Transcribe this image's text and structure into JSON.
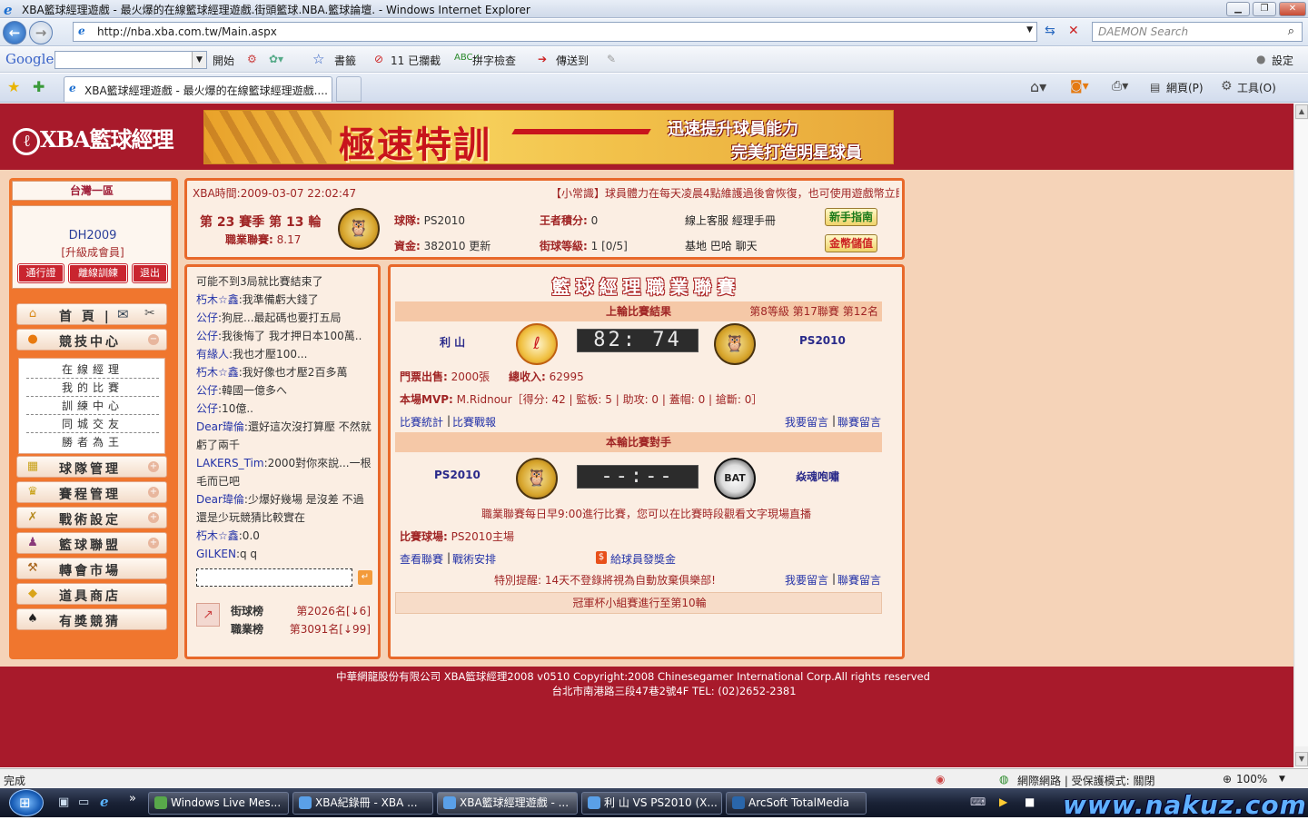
{
  "window": {
    "title": "XBA籃球經理遊戲 - 最火爆的在線籃球經理遊戲.街頭籃球.NBA.籃球論壇. - Windows Internet Explorer"
  },
  "address": {
    "url": "http://nba.xba.com.tw/Main.aspx",
    "search_placeholder": "DAEMON Search"
  },
  "google_bar": {
    "logo": "Google",
    "open": "開始",
    "bookmarks": "書籤",
    "blocked": "11 已攔截",
    "spell": "拼字檢查",
    "send": "傳送到",
    "settings": "設定"
  },
  "tabs": [
    {
      "label": "XBA籃球經理遊戲 - 最火爆的在線籃球經理遊戲...."
    }
  ],
  "ie_toolbar": {
    "page": "網頁(P)",
    "tools": "工具(O)"
  },
  "site": {
    "logo": "XBA籃球經理",
    "banner": {
      "big": "極速特訓",
      "line1": "迅速提升球員能力",
      "line2": "完美打造明星球員"
    }
  },
  "left": {
    "zone": "台灣一區",
    "user": "DH2009",
    "grade": "[升級成會員]",
    "buttons": [
      "通行證",
      "離線訓練",
      "退出"
    ],
    "menu": [
      {
        "label": "首 頁 |",
        "icon": "home-icon"
      },
      {
        "label": "競技中心",
        "icon": "basketball-icon"
      },
      {
        "label": "球隊管理",
        "icon": "team-icon"
      },
      {
        "label": "賽程管理",
        "icon": "trophy-icon"
      },
      {
        "label": "戰術設定",
        "icon": "tactics-icon"
      },
      {
        "label": "籃球聯盟",
        "icon": "league-icon"
      },
      {
        "label": "轉會市場",
        "icon": "hammer-icon"
      },
      {
        "label": "道具商店",
        "icon": "shop-icon"
      },
      {
        "label": "有獎競猜",
        "icon": "spade-icon"
      }
    ],
    "submenu": [
      "在線經理",
      "我的比賽",
      "訓練中心",
      "同城交友",
      "勝者為王"
    ]
  },
  "info": {
    "time_label": "XBA時間:",
    "time": "2009-03-07 22:02:47",
    "tip": "【小常識】球員體力在每天凌晨4點維護過後會恢復，也可使用遊戲幣立即",
    "season": "第 23 賽季 第 13 輪",
    "rating_label": "職業聯賽:",
    "rating": "8.17",
    "team_label": "球隊:",
    "team": "PS2010",
    "funds_label": "資金:",
    "funds": "382010",
    "update": "更新",
    "king_label": "王者積分:",
    "king": "0",
    "street_label": "街球等級:",
    "street": "1 [0/5]",
    "links1": "線上客服  經理手冊",
    "links2": "基地  巴哈  聊天",
    "newbie": "新手指南",
    "deposit": "金幣儲值"
  },
  "chat": {
    "messages": [
      {
        "who": "",
        "text": "可能不到3局就比賽結束了"
      },
      {
        "who": "朽木☆鑫",
        "text": ":我準備虧大錢了"
      },
      {
        "who": "公仔",
        "text": ":狗屁...最起碼也要打五局"
      },
      {
        "who": "公仔",
        "text": ":我後悔了 我才押日本100萬.."
      },
      {
        "who": "有緣人",
        "text": ":我也才壓100..."
      },
      {
        "who": "朽木☆鑫",
        "text": ":我好像也才壓2百多萬"
      },
      {
        "who": "公仔",
        "text": ":韓國一億多へ"
      },
      {
        "who": "公仔",
        "text": ":10億.."
      },
      {
        "who": "Dear瑋倫",
        "text": ":還好這次沒打算壓 不然就虧了兩千"
      },
      {
        "who": "LAKERS_Tim",
        "text": ":2000對你來說...一根毛而已吧"
      },
      {
        "who": "Dear瑋倫",
        "text": ":少爆好幾場 是沒差 不過還是少玩競猜比較實在"
      },
      {
        "who": "朽木☆鑫",
        "text": ":0.0"
      },
      {
        "who": "GILKEN",
        "text": ":q q"
      }
    ],
    "street_rank_label": "街球榜",
    "street_rank": "第2026名[↓6]",
    "pro_rank_label": "職業榜",
    "pro_rank": "第3091名[↓99]"
  },
  "league": {
    "title": "籃球經理職業聯賽",
    "last_result": "上輪比賽結果",
    "level_info": "第8等級 第17聯賽 第12名",
    "home": "利 山",
    "away": "PS2010",
    "score": "82: 74",
    "tickets_label": "門票出售:",
    "tickets": "2000張",
    "income_label": "總收入:",
    "income": "62995",
    "mvp_label": "本場MVP:",
    "mvp": "M.Ridnour［得分: 42 | 監板: 5 | 助攻: 0 | 蓋帽: 0 | 搶斷: 0］",
    "stats_link": "比賽統計",
    "report_link": "比賽戰報",
    "my_msg": "我要留言",
    "league_msg": "聯賽留言",
    "next_opp": "本輪比賽對手",
    "next_home": "PS2010",
    "next_away": "焱魂咆嘯",
    "next_score": "--:--",
    "schedule_note": "職業聯賽每日早9:00進行比賽，您可以在比賽時段觀看文字現場直播",
    "venue_label": "比賽球場:",
    "venue": "PS2010主場",
    "view_league": "查看聯賽",
    "tactics": "戰術安排",
    "bonus": "給球員發獎金",
    "reminder_label": "特別提醒:",
    "reminder": "14天不登錄將視為自動放棄俱樂部!",
    "cup": "冠軍杯小組賽進行至第10輪"
  },
  "footer": {
    "line1": "中華網龍股份有限公司  XBA籃球經理2008 v0510     Copyright:2008 Chinesegamer International Corp.All rights reserved",
    "line2": "台北市南港路三段47巷2號4F TEL: (02)2652-2381"
  },
  "status": {
    "done": "完成",
    "zone": "網際網路 | 受保護模式: 關閉",
    "zoom": "100%"
  },
  "taskbar": {
    "tasks": [
      "Windows Live Mes...",
      "XBA紀錄冊 - XBA ...",
      "XBA籃球經理遊戲 - ...",
      "利 山 VS PS2010 (X...",
      "ArcSoft TotalMedia"
    ],
    "watermark": "www.nakuz.com"
  }
}
